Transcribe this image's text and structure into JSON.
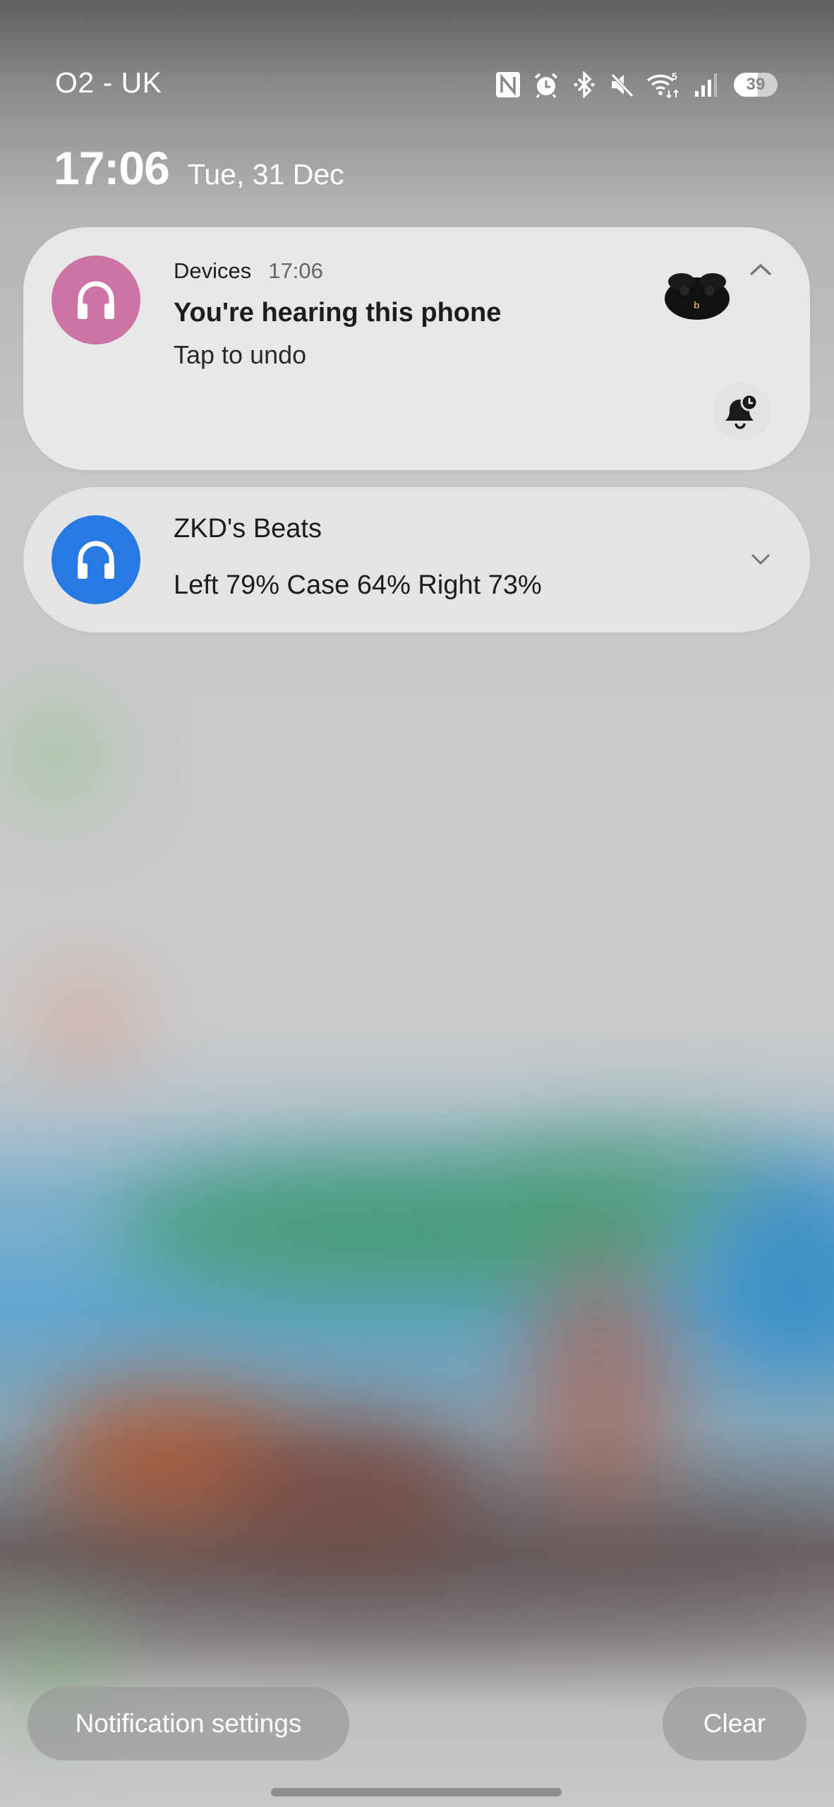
{
  "status_bar": {
    "carrier": "O2 - UK",
    "icons": [
      "nfc-icon",
      "alarm-icon",
      "bluetooth-icon",
      "mute-icon",
      "wifi-icon",
      "signal-icon"
    ],
    "wifi_badge": "5",
    "battery_level": "39"
  },
  "header": {
    "time": "17:06",
    "date": "Tue, 31 Dec"
  },
  "notifications": [
    {
      "app": "Devices",
      "time": "17:06",
      "title": "You're hearing this phone",
      "text": "Tap to undo",
      "icon": "headphones-icon",
      "icon_color": "#cd73a5",
      "expand_state": "expanded"
    },
    {
      "title": "ZKD's Beats",
      "text": "Left 79% Case 64% Right 73%",
      "icon": "headphones-icon",
      "icon_color": "#2979e3",
      "expand_state": "collapsed"
    }
  ],
  "footer": {
    "settings_label": "Notification settings",
    "clear_label": "Clear"
  }
}
